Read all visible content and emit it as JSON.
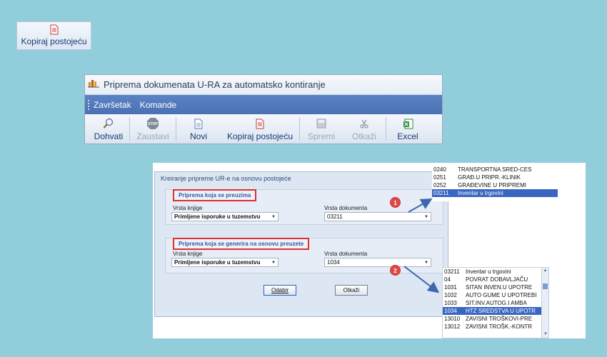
{
  "top_button": {
    "label": "Kopiraj postojeću"
  },
  "window": {
    "title": "Priprema dokumenata U-RA za automatsko kontiranje",
    "menu": [
      "Završetak",
      "Komande"
    ],
    "toolbar": {
      "dohvati": "Dohvati",
      "zaustavi": "Zaustavi",
      "zaustavi_icon_text": "STOP",
      "novi": "Novi",
      "kopiraj": "Kopiraj postojeću",
      "spremi": "Spremi",
      "otkazi": "Otkaži",
      "excel": "Excel"
    }
  },
  "dialog": {
    "title": "Kreiranje pripreme UR-e na osnovu postojeće",
    "group1": {
      "title": "Priprema koja se preuzima",
      "vrsta_knjige_label": "Vrsta knjige",
      "vrsta_knjige_value": "Primljene isporuke u tuzemstvu",
      "vrsta_dok_label": "Vrsta dokumenta",
      "vrsta_dok_value": "03211"
    },
    "group2": {
      "title": "Priprema koja se generira na osnovu preuzete",
      "vrsta_knjige_label": "Vrsta knjige",
      "vrsta_knjige_value": "Primljene isporuke u tuzemstvu",
      "vrsta_dok_label": "Vrsta dokumenta",
      "vrsta_dok_value": "1034"
    },
    "odabir": "Odabir",
    "otkazi": "Otkaži"
  },
  "list1": [
    {
      "code": "0240",
      "name": "TRANSPORTNA SRED-CES",
      "selected": false
    },
    {
      "code": "0251",
      "name": "GRAĐ.U PRIPR.-KLINIK",
      "selected": false
    },
    {
      "code": "0252",
      "name": "GRAĐEVINE U PRIPREMI",
      "selected": false
    },
    {
      "code": "03211",
      "name": "Inventar u trgovini",
      "selected": true
    }
  ],
  "list2": [
    {
      "code": "03211",
      "name": "Inventar u trgovini",
      "selected": false
    },
    {
      "code": "04",
      "name": "POVRAT DOBAVLJAČU",
      "selected": false
    },
    {
      "code": "1031",
      "name": "SITAN INVEN.U UPOTRE",
      "selected": false
    },
    {
      "code": "1032",
      "name": "AUTO GUME U UPOTREBI",
      "selected": false
    },
    {
      "code": "1033",
      "name": "SIT.INV.AUTOG.I AMBA",
      "selected": false
    },
    {
      "code": "1034",
      "name": "HTZ SREDSTVA U UPOTR",
      "selected": true
    },
    {
      "code": "13010",
      "name": "ZAVISNI TROŠKOVI-PRE",
      "selected": false
    },
    {
      "code": "13012",
      "name": "ZAVISNI TROŠK.-KONTR",
      "selected": false
    }
  ],
  "badges": [
    "1",
    "2"
  ],
  "colors": {
    "background": "#92cddb",
    "menubar": "#4f77b8",
    "selection": "#3966c2",
    "callout_border": "#e03030"
  }
}
